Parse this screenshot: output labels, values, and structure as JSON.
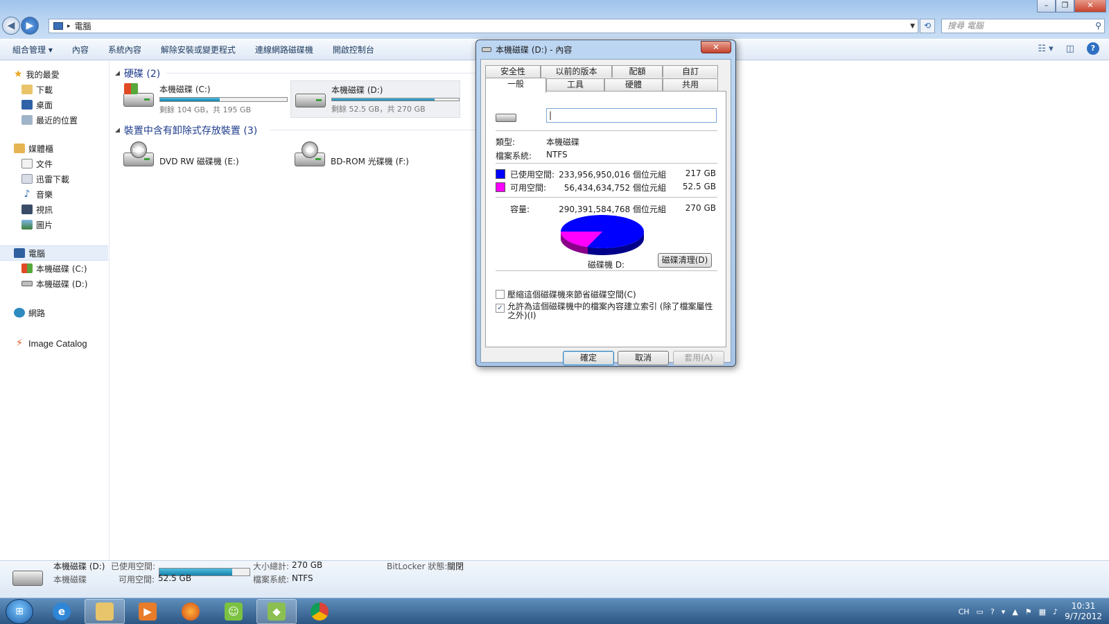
{
  "window": {
    "address": "電腦",
    "search_placeholder": "搜尋 電腦"
  },
  "toolbar": {
    "organize": "組合管理 ▾",
    "properties": "內容",
    "system_properties": "系統內容",
    "uninstall": "解除安裝或變更程式",
    "map_drive": "連線網路磁碟機",
    "control_panel": "開啟控制台"
  },
  "sidebar": {
    "favorites": "我的最愛",
    "downloads": "下載",
    "desktop": "桌面",
    "recent": "最近的位置",
    "libraries": "媒體櫃",
    "documents": "文件",
    "thunder_downloads": "迅雷下載",
    "music": "音樂",
    "videos": "視訊",
    "pictures": "圖片",
    "computer": "電腦",
    "drive_c": "本機磁碟 (C:)",
    "drive_d": "本機磁碟 (D:)",
    "network": "網路",
    "image_catalog": "Image Catalog"
  },
  "main": {
    "hdd_group": "硬碟 (2)",
    "removable_group": "裝置中含有卸除式存放裝置 (3)",
    "drive_c": {
      "name": "本機磁碟 (C:)",
      "free": "剩餘 104 GB，共 195 GB",
      "used_fraction": 0.47
    },
    "drive_d": {
      "name": "本機磁碟 (D:)",
      "free": "剩餘 52.5 GB，共 270 GB",
      "used_fraction": 0.81
    },
    "drive_e": {
      "name": "DVD RW 磁碟機 (E:)",
      "badge": "DVD"
    },
    "drive_f": {
      "name": "BD-ROM 光碟機 (F:)",
      "badge": "BD"
    }
  },
  "details": {
    "name": "本機磁碟 (D:)",
    "type": "本機磁碟",
    "used_label": "已使用空間:",
    "free_label": "可用空間:",
    "free_value": "52.5 GB",
    "total_label": "大小總計:",
    "total_value": "270 GB",
    "fs_label": "檔案系統:",
    "fs_value": "NTFS",
    "bitlocker_label": "BitLocker 狀態:",
    "bitlocker_value": "關閉",
    "used_fraction": 0.81
  },
  "dialog": {
    "title": "本機磁碟 (D:) - 內容",
    "close": "✕",
    "tabs_row1": [
      "安全性",
      "以前的版本",
      "配額",
      "自訂"
    ],
    "tabs_row2": [
      "一般",
      "工具",
      "硬體",
      "共用"
    ],
    "type_label": "類型:",
    "type_value": "本機磁碟",
    "fs_label": "檔案系統:",
    "fs_value": "NTFS",
    "used_label": "已使用空間:",
    "used_bytes": "233,956,950,016 個位元組",
    "used_size": "217 GB",
    "free_label": "可用空間:",
    "free_bytes": "56,434,634,752 個位元組",
    "free_size": "52.5 GB",
    "capacity_label": "容量:",
    "capacity_bytes": "290,391,584,768 個位元組",
    "capacity_size": "270 GB",
    "drive_label": "磁碟機 D:",
    "cleanup_button": "磁碟清理(D)",
    "compress_label": "壓縮這個磁碟機來節省磁碟空間(C)",
    "index_label": "允許為這個磁碟機中的檔案內容建立索引 (除了檔案屬性之外)(I)",
    "ok": "確定",
    "cancel": "取消",
    "apply": "套用(A)",
    "colors": {
      "used": "#0000ff",
      "free": "#ff00ff"
    }
  },
  "taskbar": {
    "lang": "CH",
    "time": "10:31",
    "date": "9/7/2012"
  }
}
